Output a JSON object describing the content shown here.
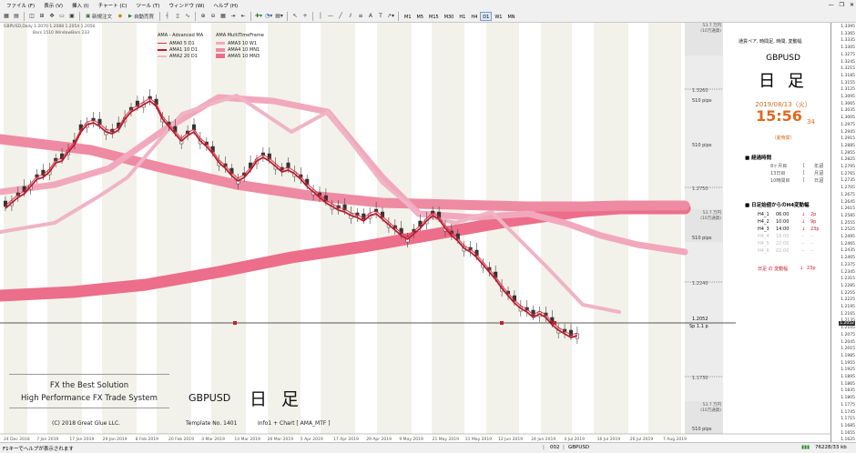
{
  "menu": [
    "ファイル (F)",
    "表示 (V)",
    "挿入 (I)",
    "チャート (C)",
    "ツール (T)",
    "ウィンドウ (W)",
    "ヘルプ (H)"
  ],
  "toolbar": {
    "new_order": "新規注文",
    "auto_trade": "自動売買",
    "timeframes": [
      "M1",
      "M5",
      "M15",
      "M30",
      "H1",
      "H4",
      "D1",
      "W1",
      "MN"
    ],
    "selected_timeframe": "D1"
  },
  "chart": {
    "info_line": "GBPUSD,Daily  1.2070 1.2088 1.2054 1.2050",
    "info_sub": "Bars 1510    WindowBars 233",
    "ama_title": "AMA - Advanced MA",
    "ama_items": [
      "AMA0  5   D1",
      "AMA1  10  D1",
      "AMA2  20  D1"
    ],
    "mtf_title": "AMA MultiTimeFrame",
    "mtf_items": [
      "AMA3  10  W1",
      "AMA4  10  MN1",
      "AMA5  10  MN3"
    ],
    "dates": [
      "24 Dec 2018",
      "7 Jan 2019",
      "17 Jan 2019",
      "29 Jan 2019",
      "8 Feb 2019",
      "20 Feb 2019",
      "4 Mar 2019",
      "14 Mar 2019",
      "26 Mar 2019",
      "5 Apr 2019",
      "17 Apr 2019",
      "29 Apr 2019",
      "9 May 2019",
      "21 May 2019",
      "31 May 2019",
      "12 Jun 2019",
      "24 Jun 2019",
      "4 Jul 2019",
      "16 Jul 2019",
      "26 Jul 2019",
      "7 Aug 2019"
    ],
    "zones": [
      {
        "top_label": "53.7 万円",
        "top_sub": "(10万通貨)",
        "pips": "510 pips",
        "price": "1.3260"
      },
      {
        "top_label": "",
        "top_sub": "",
        "pips": "510 pips",
        "price": "1.2750"
      },
      {
        "top_label": "53.7 万円",
        "top_sub": "(10万通貨)",
        "pips": "510 pips",
        "price": "1.2240"
      },
      {
        "top_label": "",
        "top_sub": "",
        "pips": "",
        "price": "1.1730"
      },
      {
        "top_label": "53.7 万円",
        "top_sub": "(10万通貨)",
        "pips": "510 pips",
        "price": ""
      }
    ],
    "current_price": "1.2052",
    "spread": "Sp  1.1 p",
    "watermark": {
      "line1": "FX the Best Solution",
      "line2": "High Performance FX Trade System",
      "symbol": "GBPUSD",
      "period": "日 足"
    },
    "footer": {
      "copyright": "(C)  2018   Great Glue LLC.",
      "template_label": "Template   No. 1401",
      "info": "Info1   +   Chart   [ AMA_MTF ]"
    }
  },
  "panel": {
    "header": "通貨ペア, 時間足, 時間, 変動幅",
    "symbol": "GBPUSD",
    "period": "日 足",
    "date": "2019/08/13（火）",
    "time_hm": "15:56",
    "time_s": "34",
    "dst": "（夏時間）",
    "elapsed_title": "■ 経過時間",
    "elapsed_rows": [
      [
        "8ヶ月目",
        "[",
        "年足",
        "]"
      ],
      [
        "13日目",
        "[",
        "月足",
        "]"
      ],
      [
        "10時間目",
        "[",
        "日足",
        "]"
      ]
    ],
    "h4_title": "■ 日足始値からのH4変動幅",
    "h4_rows": [
      {
        "name": "H4_1",
        "time": "06:00",
        "arrow": "↓",
        "val": "2p",
        "active": true
      },
      {
        "name": "H4_2",
        "time": "10:00",
        "arrow": "↓",
        "val": "9p",
        "active": true
      },
      {
        "name": "H4_3",
        "time": "14:00",
        "arrow": "↓",
        "val": "23p",
        "active": true
      },
      {
        "name": "H4_4",
        "time": "18:00",
        "arrow": "--",
        "val": "--",
        "active": false
      },
      {
        "name": "H4_5",
        "time": "22:00",
        "arrow": "--",
        "val": "--",
        "active": false
      },
      {
        "name": "H4_6",
        "time": "02:00",
        "arrow": "--",
        "val": "--",
        "active": false
      }
    ],
    "day_change_label": "日足 の 変動幅",
    "day_change_arrow": "↓",
    "day_change_val": "23p"
  },
  "price_axis": [
    "1.3395",
    "1.3365",
    "1.3335",
    "1.3305",
    "1.3275",
    "1.3245",
    "1.3215",
    "1.3185",
    "1.3155",
    "1.3125",
    "1.3095",
    "1.3065",
    "1.3035",
    "1.3005",
    "1.2975",
    "1.2945",
    "1.2915",
    "1.2885",
    "1.2855",
    "1.2825",
    "1.2795",
    "1.2765",
    "1.2735",
    "1.2705",
    "1.2675",
    "1.2645",
    "1.2615",
    "1.2585",
    "1.2555",
    "1.2525",
    "1.2495",
    "1.2465",
    "1.2435",
    "1.2405",
    "1.2375",
    "1.2345",
    "1.2315",
    "1.2285",
    "1.2255",
    "1.2225",
    "1.2195",
    "1.2165",
    "1.2135",
    "1.2105",
    "1.2075",
    "1.2045",
    "1.2015",
    "1.1985",
    "1.1955",
    "1.1925",
    "1.1895",
    "1.1865",
    "1.1835",
    "1.1805",
    "1.1775",
    "1.1745",
    "1.1715",
    "1.1685",
    "1.1655",
    "1.1625"
  ],
  "price_marker": "1.2052",
  "status": {
    "help": "F1キーでヘルプが表示されます",
    "profile": "002",
    "symbol": "GBPUSD",
    "traffic": "76228/33 kb"
  },
  "colors": {
    "ama0": "#e0283c",
    "ama1": "#b81c30",
    "ama2": "#f0b4c4",
    "w1": "#f2a8bc",
    "mn1": "#ee8aa2",
    "mn3": "#ec6e8a",
    "band": "#f2f2ea",
    "orange": "#e06a1e"
  }
}
